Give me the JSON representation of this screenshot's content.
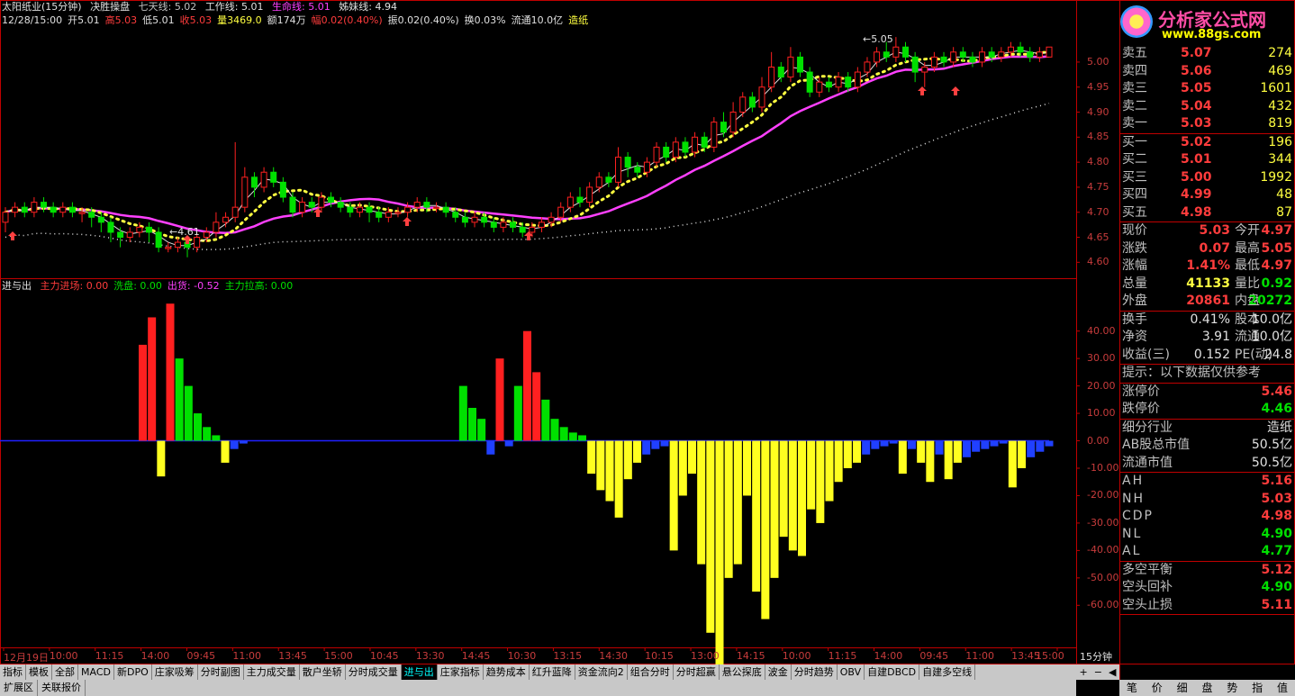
{
  "header": {
    "stock": "太阳纸业(15分钟)",
    "indicator": "决胜操盘",
    "qitian_label": "七天线:",
    "qitian_val": "5.02",
    "gongzuo_label": "工作线:",
    "gongzuo_val": "5.01",
    "shengming_label": "生命线:",
    "shengming_val": "5.01",
    "meimei_label": "姊妹线:",
    "meimei_val": "4.94",
    "row2": [
      {
        "t": "12/28/15:00",
        "c": "white"
      },
      {
        "t": "开5.01",
        "c": "white"
      },
      {
        "t": "高5.03",
        "c": "red"
      },
      {
        "t": "低5.01",
        "c": "white"
      },
      {
        "t": "收5.03",
        "c": "red"
      },
      {
        "t": "量3469.0",
        "c": "yellow"
      },
      {
        "t": "额174万",
        "c": "white"
      },
      {
        "t": "幅0.02(0.40%)",
        "c": "red"
      },
      {
        "t": "振0.02(0.40%)",
        "c": "white"
      },
      {
        "t": "换0.03%",
        "c": "white"
      },
      {
        "t": "流通10.0亿",
        "c": "white"
      },
      {
        "t": "造纸",
        "c": "yellow"
      }
    ],
    "sub_title": "进与出",
    "sub_items": [
      {
        "t": "主力进场: 0.00",
        "c": "red"
      },
      {
        "t": "洗盘: 0.00",
        "c": "green"
      },
      {
        "t": "出货: -0.52",
        "c": "magenta"
      },
      {
        "t": "主力拉高: 0.00",
        "c": "green"
      }
    ]
  },
  "logo": {
    "title": "分析家公式网",
    "url": "www.88gs.com"
  },
  "annotations": {
    "high": "5.05",
    "low": "4.61"
  },
  "price_axis": [
    "5.00",
    "4.95",
    "4.90",
    "4.85",
    "4.80",
    "4.75",
    "4.70",
    "4.65",
    "4.60"
  ],
  "sub_axis": [
    "40.00",
    "30.00",
    "20.00",
    "10.00",
    "0.00",
    "-10.00",
    "-20.00",
    "-30.00",
    "-40.00",
    "-50.00",
    "-60.00"
  ],
  "time_axis": [
    "12月19日",
    "10:00",
    "11:15",
    "14:00",
    "09:45",
    "11:00",
    "13:45",
    "15:00",
    "10:45",
    "13:30",
    "14:45",
    "10:30",
    "13:15",
    "14:30",
    "10:15",
    "13:00",
    "14:15",
    "10:00",
    "11:15",
    "14:00",
    "09:45",
    "11:00",
    "13:45",
    "15:00"
  ],
  "period_label": "15分钟",
  "quote": {
    "sell": [
      {
        "l": "卖五",
        "p": "5.07",
        "v": "274"
      },
      {
        "l": "卖四",
        "p": "5.06",
        "v": "469"
      },
      {
        "l": "卖三",
        "p": "5.05",
        "v": "1601"
      },
      {
        "l": "卖二",
        "p": "5.04",
        "v": "432"
      },
      {
        "l": "卖一",
        "p": "5.03",
        "v": "819"
      }
    ],
    "buy": [
      {
        "l": "买一",
        "p": "5.02",
        "v": "196"
      },
      {
        "l": "买二",
        "p": "5.01",
        "v": "344"
      },
      {
        "l": "买三",
        "p": "5.00",
        "v": "1992"
      },
      {
        "l": "买四",
        "p": "4.99",
        "v": "48"
      },
      {
        "l": "买五",
        "p": "4.98",
        "v": "87"
      }
    ],
    "stats": [
      {
        "l": "现价",
        "v": "5.03",
        "vc": "red",
        "l2": "今开",
        "v2": "4.97",
        "v2c": "red"
      },
      {
        "l": "涨跌",
        "v": "0.07",
        "vc": "red",
        "l2": "最高",
        "v2": "5.05",
        "v2c": "red"
      },
      {
        "l": "涨幅",
        "v": "1.41%",
        "vc": "red",
        "l2": "最低",
        "v2": "4.97",
        "v2c": "red"
      },
      {
        "l": "总量",
        "v": "41133",
        "vc": "yellow",
        "l2": "量比",
        "v2": "0.92",
        "v2c": "green"
      },
      {
        "l": "外盘",
        "v": "20861",
        "vc": "red",
        "l2": "内盘",
        "v2": "20272",
        "v2c": "green"
      }
    ],
    "stats2": [
      {
        "l": "换手",
        "v": "0.41%",
        "l2": "股本",
        "v2": "10.0亿"
      },
      {
        "l": "净资",
        "v": "3.91",
        "l2": "流通",
        "v2": "10.0亿"
      },
      {
        "l": "收益(三)",
        "v": "0.152",
        "l2": "PE(动)",
        "v2": "24.8"
      }
    ],
    "tip": "提示：以下数据仅供参考",
    "limits": [
      {
        "l": "涨停价",
        "v": "5.46",
        "c": "red"
      },
      {
        "l": "跌停价",
        "v": "4.46",
        "c": "green"
      }
    ],
    "info": [
      {
        "l": "细分行业",
        "v": "造纸"
      },
      {
        "l": "AB股总市值",
        "v": "50.5亿"
      },
      {
        "l": "流通市值",
        "v": "50.5亿"
      }
    ],
    "levels": [
      {
        "l": "AH",
        "v": "5.16",
        "c": "red"
      },
      {
        "l": "NH",
        "v": "5.03",
        "c": "red"
      },
      {
        "l": "CDP",
        "v": "4.98",
        "c": "red"
      },
      {
        "l": "NL",
        "v": "4.90",
        "c": "green"
      },
      {
        "l": "AL",
        "v": "4.77",
        "c": "green"
      }
    ],
    "balance": [
      {
        "l": "多空平衡",
        "v": "5.12",
        "c": "red"
      },
      {
        "l": "空头回补",
        "v": "4.90",
        "c": "green"
      },
      {
        "l": "空头止损",
        "v": "5.11",
        "c": "red"
      }
    ]
  },
  "tabs": [
    "指标",
    "模板",
    "全部",
    "MACD",
    "新DPO",
    "庄家吸筹",
    "分时副图",
    "主力成交量",
    "散户坐轿",
    "分时成交量",
    "进与出",
    "庄家指标",
    "趋势成本",
    "红升蓝降",
    "资金流向2",
    "组合分时",
    "分时超赢",
    "悬公探底",
    "波金",
    "分时趋势",
    "OBV",
    "自建DBCD",
    "自建多空线"
  ],
  "active_tab": "进与出",
  "tab_controls": [
    "+",
    "−",
    "◀"
  ],
  "bottom_tabs": [
    "扩展区",
    "关联报价"
  ],
  "right_tabs": [
    "笔",
    "价",
    "细",
    "盘",
    "势",
    "指",
    "值"
  ],
  "chart_data": {
    "type": "candlestick",
    "ylim": [
      4.57,
      5.07
    ],
    "candles": [
      [
        4.68,
        4.7,
        4.66,
        4.71
      ],
      [
        4.7,
        4.71,
        4.69,
        4.72
      ],
      [
        4.71,
        4.7,
        4.69,
        4.72
      ],
      [
        4.7,
        4.72,
        4.69,
        4.73
      ],
      [
        4.72,
        4.71,
        4.7,
        4.73
      ],
      [
        4.71,
        4.7,
        4.69,
        4.72
      ],
      [
        4.7,
        4.71,
        4.69,
        4.72
      ],
      [
        4.71,
        4.7,
        4.69,
        4.72
      ],
      [
        4.7,
        4.7,
        4.68,
        4.71
      ],
      [
        4.7,
        4.69,
        4.67,
        4.71
      ],
      [
        4.69,
        4.68,
        4.66,
        4.7
      ],
      [
        4.68,
        4.66,
        4.64,
        4.69
      ],
      [
        4.66,
        4.65,
        4.63,
        4.67
      ],
      [
        4.65,
        4.66,
        4.64,
        4.67
      ],
      [
        4.66,
        4.67,
        4.65,
        4.68
      ],
      [
        4.67,
        4.66,
        4.64,
        4.68
      ],
      [
        4.66,
        4.63,
        4.62,
        4.67
      ],
      [
        4.63,
        4.63,
        4.62,
        4.64
      ],
      [
        4.63,
        4.64,
        4.62,
        4.65
      ],
      [
        4.64,
        4.63,
        4.61,
        4.65
      ],
      [
        4.63,
        4.65,
        4.62,
        4.66
      ],
      [
        4.65,
        4.66,
        4.64,
        4.67
      ],
      [
        4.66,
        4.68,
        4.65,
        4.7
      ],
      [
        4.68,
        4.69,
        4.67,
        4.7
      ],
      [
        4.69,
        4.71,
        4.68,
        4.84
      ],
      [
        4.71,
        4.77,
        4.7,
        4.79
      ],
      [
        4.77,
        4.75,
        4.73,
        4.78
      ],
      [
        4.75,
        4.78,
        4.74,
        4.79
      ],
      [
        4.78,
        4.76,
        4.75,
        4.79
      ],
      [
        4.76,
        4.73,
        4.72,
        4.77
      ],
      [
        4.73,
        4.7,
        4.69,
        4.74
      ],
      [
        4.7,
        4.72,
        4.69,
        4.73
      ],
      [
        4.72,
        4.71,
        4.7,
        4.73
      ],
      [
        4.71,
        4.73,
        4.7,
        4.74
      ],
      [
        4.73,
        4.72,
        4.71,
        4.74
      ],
      [
        4.72,
        4.71,
        4.7,
        4.73
      ],
      [
        4.71,
        4.7,
        4.69,
        4.72
      ],
      [
        4.7,
        4.71,
        4.69,
        4.72
      ],
      [
        4.71,
        4.7,
        4.68,
        4.72
      ],
      [
        4.7,
        4.69,
        4.68,
        4.71
      ],
      [
        4.69,
        4.7,
        4.68,
        4.71
      ],
      [
        4.7,
        4.7,
        4.69,
        4.71
      ],
      [
        4.7,
        4.71,
        4.69,
        4.72
      ],
      [
        4.71,
        4.72,
        4.7,
        4.73
      ],
      [
        4.72,
        4.71,
        4.7,
        4.73
      ],
      [
        4.71,
        4.71,
        4.7,
        4.72
      ],
      [
        4.71,
        4.7,
        4.69,
        4.72
      ],
      [
        4.7,
        4.69,
        4.68,
        4.71
      ],
      [
        4.69,
        4.68,
        4.67,
        4.7
      ],
      [
        4.68,
        4.69,
        4.67,
        4.7
      ],
      [
        4.69,
        4.68,
        4.67,
        4.7
      ],
      [
        4.68,
        4.67,
        4.66,
        4.69
      ],
      [
        4.67,
        4.68,
        4.66,
        4.69
      ],
      [
        4.68,
        4.67,
        4.66,
        4.69
      ],
      [
        4.67,
        4.66,
        4.65,
        4.68
      ],
      [
        4.66,
        4.67,
        4.65,
        4.68
      ],
      [
        4.67,
        4.68,
        4.66,
        4.69
      ],
      [
        4.68,
        4.69,
        4.67,
        4.7
      ],
      [
        4.69,
        4.71,
        4.68,
        4.72
      ],
      [
        4.71,
        4.73,
        4.7,
        4.74
      ],
      [
        4.73,
        4.72,
        4.71,
        4.75
      ],
      [
        4.72,
        4.75,
        4.71,
        4.76
      ],
      [
        4.75,
        4.77,
        4.74,
        4.78
      ],
      [
        4.77,
        4.76,
        4.75,
        4.78
      ],
      [
        4.76,
        4.81,
        4.75,
        4.83
      ],
      [
        4.81,
        4.79,
        4.77,
        4.82
      ],
      [
        4.79,
        4.78,
        4.77,
        4.8
      ],
      [
        4.78,
        4.8,
        4.77,
        4.81
      ],
      [
        4.8,
        4.83,
        4.79,
        4.84
      ],
      [
        4.83,
        4.81,
        4.8,
        4.84
      ],
      [
        4.81,
        4.84,
        4.8,
        4.85
      ],
      [
        4.84,
        4.82,
        4.81,
        4.85
      ],
      [
        4.82,
        4.85,
        4.81,
        4.86
      ],
      [
        4.85,
        4.83,
        4.82,
        4.86
      ],
      [
        4.83,
        4.88,
        4.82,
        4.89
      ],
      [
        4.88,
        4.86,
        4.85,
        4.9
      ],
      [
        4.86,
        4.9,
        4.85,
        4.92
      ],
      [
        4.9,
        4.93,
        4.89,
        4.94
      ],
      [
        4.93,
        4.91,
        4.9,
        4.94
      ],
      [
        4.91,
        4.95,
        4.9,
        4.97
      ],
      [
        4.95,
        4.99,
        4.94,
        5.02
      ],
      [
        4.99,
        4.97,
        4.96,
        5.0
      ],
      [
        4.97,
        5.01,
        4.96,
        5.03
      ],
      [
        5.01,
        4.98,
        4.97,
        5.02
      ],
      [
        4.98,
        4.94,
        4.93,
        4.99
      ],
      [
        4.94,
        4.96,
        4.93,
        4.97
      ],
      [
        4.96,
        4.95,
        4.94,
        4.97
      ],
      [
        4.95,
        4.97,
        4.94,
        4.98
      ],
      [
        4.97,
        4.95,
        4.94,
        4.98
      ],
      [
        4.95,
        4.98,
        4.94,
        4.99
      ],
      [
        4.98,
        5.0,
        4.97,
        5.01
      ],
      [
        5.0,
        5.02,
        4.99,
        5.03
      ],
      [
        5.02,
        5.01,
        5.0,
        5.04
      ],
      [
        5.01,
        5.03,
        5.0,
        5.05
      ],
      [
        5.03,
        5.01,
        5.0,
        5.04
      ],
      [
        5.01,
        4.98,
        4.96,
        5.02
      ],
      [
        4.98,
        4.99,
        4.95,
        5.0
      ],
      [
        4.99,
        5.01,
        4.98,
        5.02
      ],
      [
        5.01,
        5.0,
        4.99,
        5.02
      ],
      [
        5.0,
        5.02,
        4.99,
        5.03
      ],
      [
        5.02,
        5.01,
        5.0,
        5.03
      ],
      [
        5.01,
        5.0,
        4.99,
        5.02
      ],
      [
        5.0,
        5.02,
        4.99,
        5.03
      ],
      [
        5.02,
        5.01,
        5.0,
        5.03
      ],
      [
        5.01,
        5.02,
        5.0,
        5.03
      ],
      [
        5.02,
        5.03,
        5.01,
        5.04
      ],
      [
        5.03,
        5.02,
        5.01,
        5.04
      ],
      [
        5.02,
        5.01,
        5.0,
        5.03
      ],
      [
        5.01,
        5.02,
        5.0,
        5.03
      ],
      [
        5.01,
        5.03,
        5.01,
        5.03
      ]
    ],
    "sub_bars": [
      0,
      0,
      0,
      0,
      0,
      0,
      0,
      0,
      0,
      0,
      0,
      0,
      0,
      0,
      0,
      35,
      45,
      -13,
      50,
      30,
      20,
      10,
      5,
      2,
      -8,
      -3,
      -1,
      0,
      0,
      0,
      0,
      0,
      0,
      0,
      0,
      0,
      0,
      0,
      0,
      0,
      0,
      0,
      0,
      0,
      0,
      0,
      0,
      0,
      0,
      0,
      20,
      12,
      8,
      -5,
      30,
      -2,
      20,
      40,
      25,
      15,
      8,
      5,
      3,
      2,
      -12,
      -18,
      -22,
      -28,
      -14,
      -8,
      -5,
      -3,
      -2,
      -40,
      -20,
      -12,
      -45,
      -70,
      -88,
      -50,
      -45,
      -20,
      -55,
      -65,
      -50,
      -35,
      -40,
      -42,
      -25,
      -30,
      -22,
      -15,
      -10,
      -8,
      -5,
      -3,
      -2,
      -1,
      -12,
      -3,
      -8,
      -15,
      -5,
      -14,
      -8,
      -6,
      -4,
      -3,
      -2,
      -1,
      -17,
      -10,
      -6,
      -4,
      -2
    ]
  }
}
